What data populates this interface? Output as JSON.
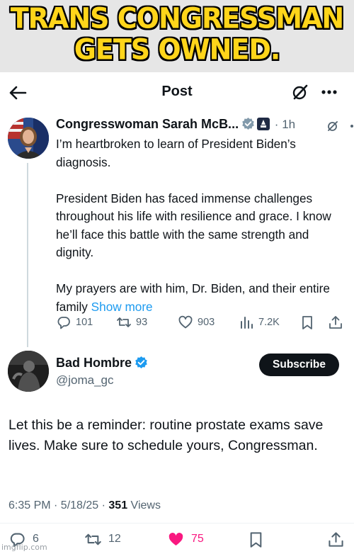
{
  "meme": {
    "caption_line1": "TRANS CONGRESSMAN",
    "caption_line2": "GETS OWNED."
  },
  "header": {
    "title": "Post",
    "back_icon": "arrow-left-icon",
    "grok_icon": "grok-icon",
    "more_icon": "more-horizontal-icon"
  },
  "tweet1": {
    "author_name": "Congresswoman Sarah McB...",
    "badges": [
      "verified-badge-icon",
      "government-badge-icon"
    ],
    "time": "1h",
    "body": [
      "I’m heartbroken to learn of President Biden’s diagnosis.",
      "President Biden has faced immense challenges throughout his life with resilience and grace. I know he’ll face this battle with the same strength and dignity.",
      "My prayers are with him, Dr. Biden, and their entire family"
    ],
    "show_more": "Show more",
    "actions": {
      "replies": "101",
      "reposts": "93",
      "likes": "903",
      "views": "7.2K"
    }
  },
  "tweet2": {
    "author_name": "Bad Hombre",
    "handle": "@joma_gc",
    "subscribe_label": "Subscribe",
    "body": "Let this be a reminder: routine prostate exams save lives. Make sure to schedule yours, Congressman.",
    "timestamp": "6:35 PM · 5/18/25 · ",
    "views": "351",
    "views_label": " Views",
    "actions": {
      "replies": "6",
      "reposts": "12",
      "likes": "75"
    }
  },
  "colors": {
    "accent": "#1d9bf0",
    "like": "#f91880",
    "meme_text": "#ffd51a"
  },
  "watermark": "imgflip.com"
}
